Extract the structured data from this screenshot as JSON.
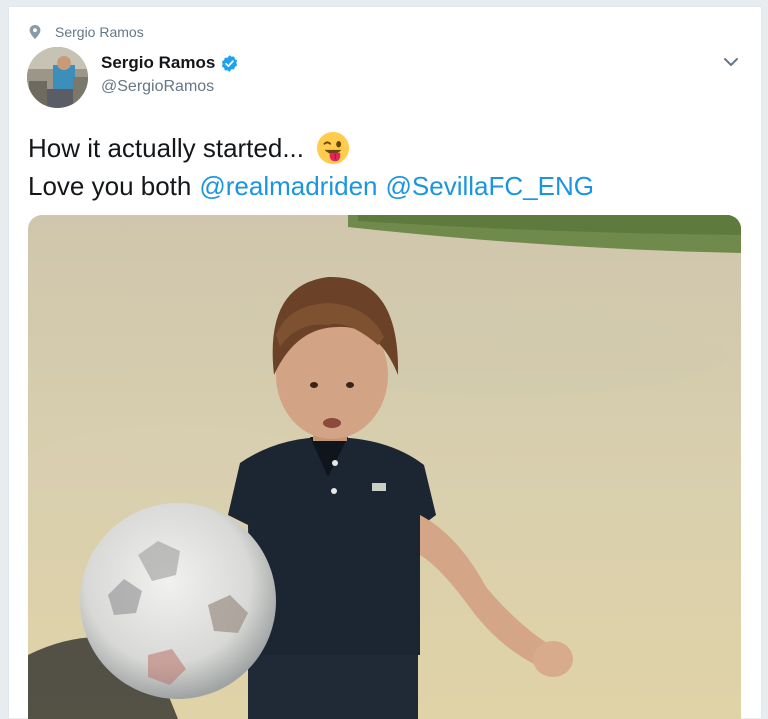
{
  "context": {
    "label": "Sergio Ramos",
    "icon": "location-pin-icon"
  },
  "author": {
    "display_name": "Sergio Ramos",
    "handle": "@SergioRamos",
    "verified_icon": "verified-badge-icon"
  },
  "menu": {
    "icon": "chevron-down-icon"
  },
  "tweet": {
    "line1": "How it actually started...",
    "line1_emoji": "winking-face-with-tongue-emoji",
    "line2_prefix": "Love you both",
    "mentions": [
      "@realmadriden",
      "@SevillaFC_ENG"
    ]
  },
  "colors": {
    "link": "#1b95e0",
    "secondary_text": "#657786",
    "verified": "#1da1f2"
  }
}
